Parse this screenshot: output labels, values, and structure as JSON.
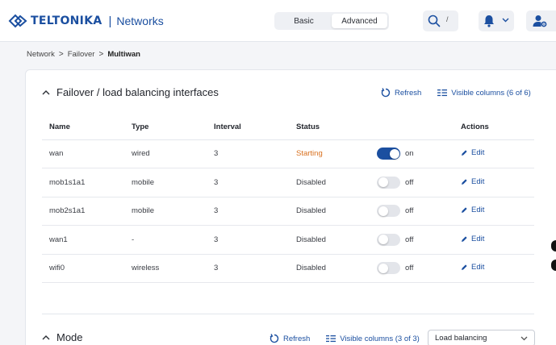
{
  "header": {
    "brand_name": "TELTONIKA",
    "separator": "|",
    "product": "Networks",
    "modes": [
      "Basic",
      "Advanced"
    ],
    "active_mode": "Advanced",
    "search_shortcut": "/"
  },
  "breadcrumb": {
    "items": [
      "Network",
      "Failover"
    ],
    "separator": ">",
    "current": "Multiwan"
  },
  "interfaces_section": {
    "title": "Failover / load balancing interfaces",
    "refresh_label": "Refresh",
    "visible_columns_label": "Visible columns (6 of 6)",
    "columns": [
      "Name",
      "Type",
      "Interval",
      "Status",
      "",
      "Actions"
    ],
    "rows": [
      {
        "name": "wan",
        "type": "wired",
        "interval": "3",
        "status": "Starting",
        "enabled": true,
        "toggle_label": "on",
        "action": "Edit"
      },
      {
        "name": "mob1s1a1",
        "type": "mobile",
        "interval": "3",
        "status": "Disabled",
        "enabled": false,
        "toggle_label": "off",
        "action": "Edit"
      },
      {
        "name": "mob2s1a1",
        "type": "mobile",
        "interval": "3",
        "status": "Disabled",
        "enabled": false,
        "toggle_label": "off",
        "action": "Edit"
      },
      {
        "name": "wan1",
        "type": "-",
        "interval": "3",
        "status": "Disabled",
        "enabled": false,
        "toggle_label": "off",
        "action": "Edit"
      },
      {
        "name": "wifi0",
        "type": "wireless",
        "interval": "3",
        "status": "Disabled",
        "enabled": false,
        "toggle_label": "off",
        "action": "Edit"
      }
    ]
  },
  "mode_section": {
    "title": "Mode",
    "refresh_label": "Refresh",
    "visible_columns_label": "Visible columns (3 of 3)",
    "select_value": "Load balancing"
  },
  "colors": {
    "accent": "#1b4fa0",
    "status_starting": "#d9701e",
    "background": "#f4f5f8"
  }
}
